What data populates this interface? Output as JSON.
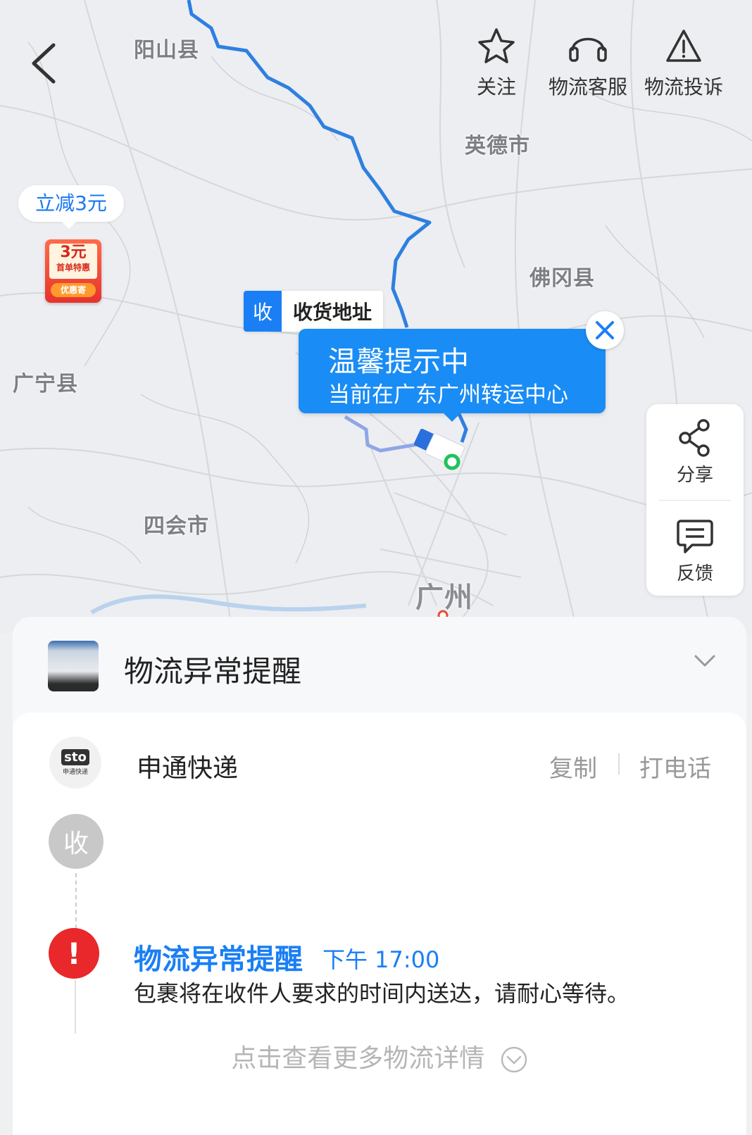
{
  "nav": {
    "back_icon": "chevron-left-icon",
    "follow_label": "关注",
    "service_label": "物流客服",
    "complaint_label": "物流投诉"
  },
  "map": {
    "cities": {
      "yangshan": "阳山县",
      "yingde": "英德市",
      "fogang": "佛冈县",
      "guangning": "广宁县",
      "sihui": "四会市",
      "guangzhou": "广州"
    },
    "route_color": "#2f7fe0"
  },
  "promo": {
    "bubble": "立减3元",
    "coupon_amount": "3元",
    "coupon_sub": "首单特惠",
    "coupon_btn": "优惠寄"
  },
  "destination": {
    "badge": "收",
    "label": "收货地址"
  },
  "tip": {
    "title": "温馨提示中",
    "subtitle": "当前在广东广州转运中心"
  },
  "side": {
    "share_label": "分享",
    "feedback_label": "反馈"
  },
  "alert": {
    "title": "物流异常提醒"
  },
  "carrier": {
    "logo_text": "sto",
    "logo_sub": "申通快递",
    "name": "申通快递",
    "copy": "复制",
    "call": "打电话"
  },
  "timeline": {
    "recv_badge": "收",
    "event_title": "物流异常提醒",
    "event_time": "下午  17:00",
    "event_desc": "包裹将在收件人要求的时间内送达，请耐心等待。",
    "more": "点击查看更多物流详情"
  },
  "colors": {
    "accent": "#1a7ff5",
    "alert_red": "#e8282a"
  }
}
